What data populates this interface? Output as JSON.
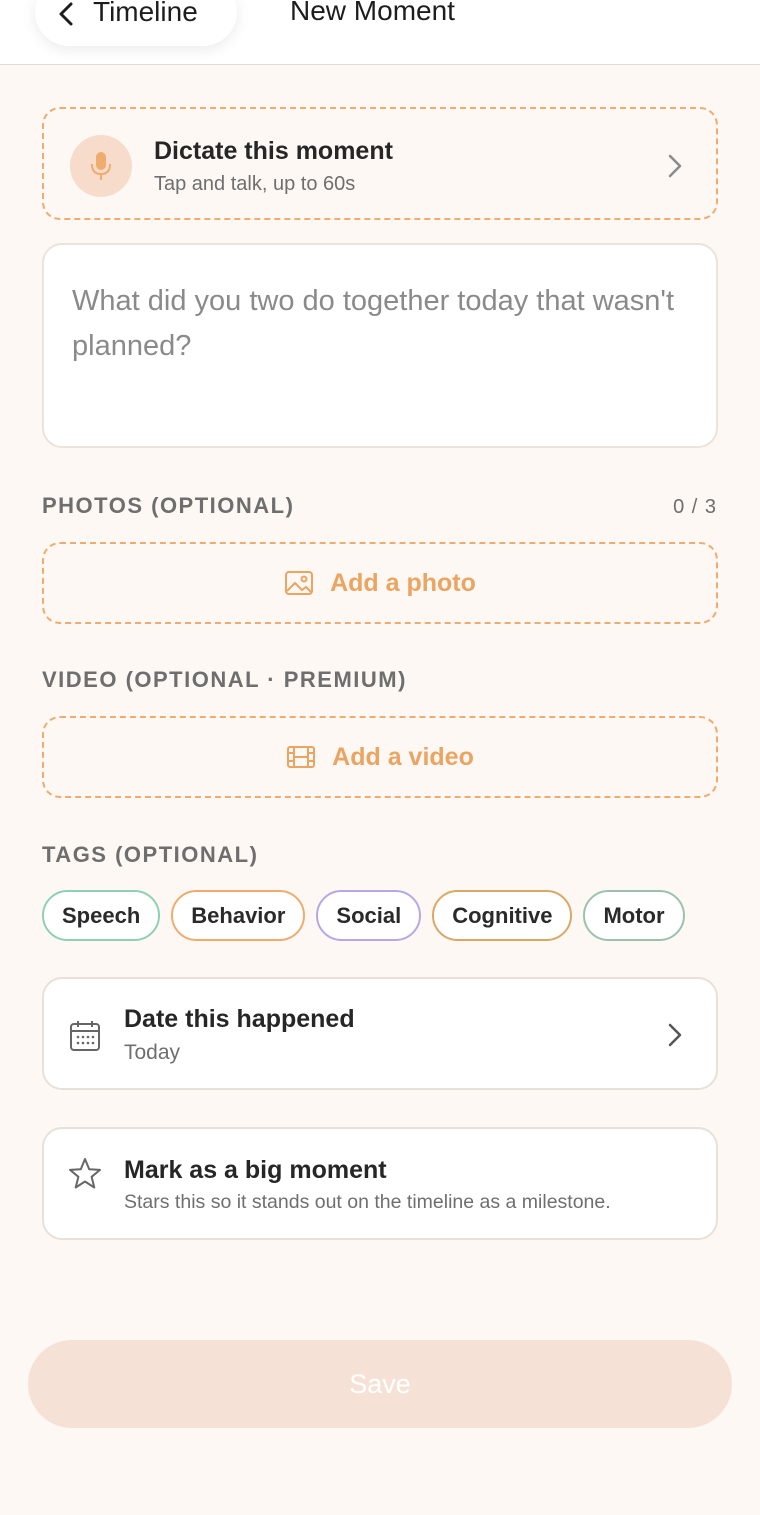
{
  "header": {
    "back_label": "Timeline",
    "title": "New Moment"
  },
  "dictate": {
    "title": "Dictate this moment",
    "subtitle": "Tap and talk, up to 60s"
  },
  "entry": {
    "placeholder": "What did you two do together today that wasn't planned?"
  },
  "photos": {
    "label": "PHOTOS (OPTIONAL)",
    "count": "0 / 3",
    "button_label": "Add a photo"
  },
  "video": {
    "label": "VIDEO (OPTIONAL · PREMIUM)",
    "button_label": "Add a video"
  },
  "tags": {
    "label": "TAGS (OPTIONAL)",
    "items": [
      {
        "label": "Speech",
        "color": "#8fcfb6"
      },
      {
        "label": "Behavior",
        "color": "#f0ab6e"
      },
      {
        "label": "Social",
        "color": "#b7a7e3"
      },
      {
        "label": "Cognitive",
        "color": "#d9a865"
      },
      {
        "label": "Motor",
        "color": "#9cc2ad"
      }
    ]
  },
  "date": {
    "title": "Date this happened",
    "value": "Today"
  },
  "big_moment": {
    "title": "Mark as a big moment",
    "description": "Stars this so it stands out on the timeline as a milestone."
  },
  "save_label": "Save",
  "colors": {
    "accent": "#f0ab6e",
    "background": "#fdf8f3",
    "save_disabled": "#f5e1d5"
  }
}
